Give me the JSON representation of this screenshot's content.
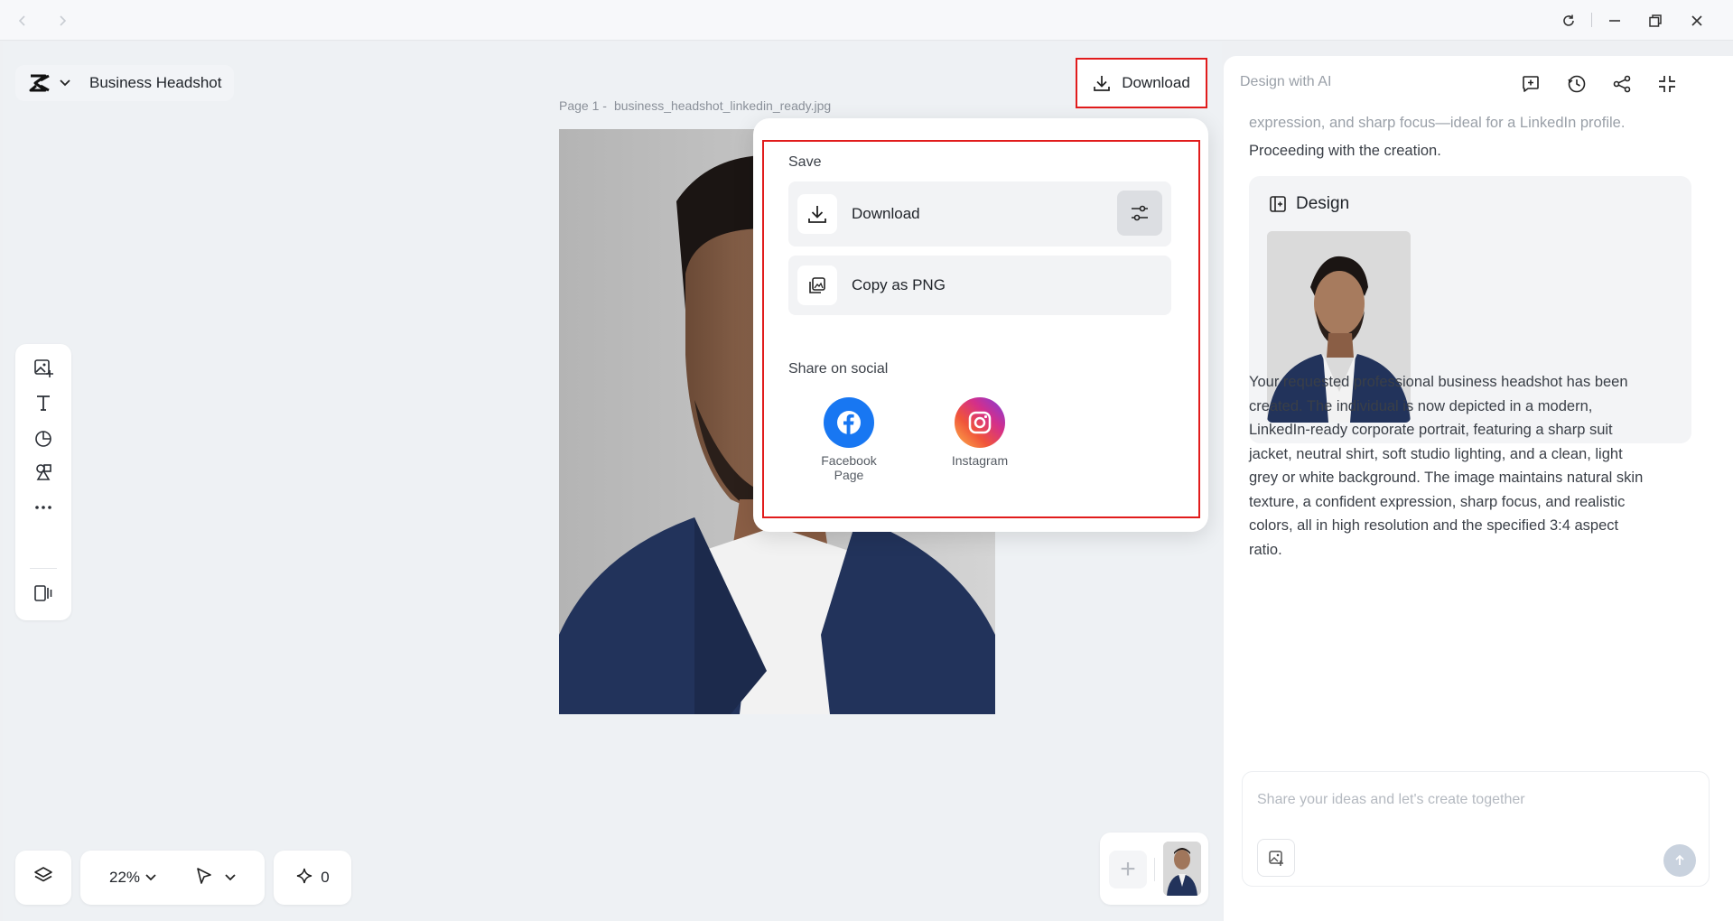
{
  "project": {
    "title": "Business Headshot"
  },
  "canvas": {
    "page_prefix": "Page 1 -",
    "file_name": "business_headshot_linkedin_ready.jpg",
    "zoom": "22%",
    "credits": "0"
  },
  "header": {
    "download_label": "Download"
  },
  "popover": {
    "save_heading": "Save",
    "download_label": "Download",
    "copy_label": "Copy as PNG",
    "share_heading": "Share on social",
    "social": [
      {
        "label_line1": "Facebook",
        "label_line2": "Page"
      },
      {
        "label_line1": "Instagram"
      }
    ]
  },
  "right_panel": {
    "title": "Design with AI",
    "faded_text": "expression, and sharp focus—ideal for a LinkedIn profile.",
    "proceed_text": "Proceeding with the creation.",
    "design_heading": "Design",
    "result_lines": [
      "Your requested professional business headshot has been",
      "created. The individual is now depicted in a modern,",
      "LinkedIn-ready corporate portrait, featuring a sharp suit",
      "jacket, neutral shirt, soft studio lighting, and a clean, light",
      "grey or white background. The image maintains natural skin",
      "texture, a confident expression, sharp focus, and realistic",
      "colors, all in high resolution and the specified 3:4 aspect",
      "ratio."
    ],
    "chat_placeholder": "Share your ideas and let's create together"
  },
  "colors": {
    "highlight": "#e11c1c",
    "facebook": "#1877f2",
    "suit": "#22335b"
  },
  "icons": [
    "back-icon",
    "forward-icon",
    "refresh-icon",
    "minimize-icon",
    "restore-icon",
    "close-icon",
    "logo-icon",
    "chevron-down-icon",
    "image-add-icon",
    "text-icon",
    "shape-icon",
    "elements-icon",
    "more-icon",
    "resize-icon",
    "layers-icon",
    "cursor-icon",
    "sparkle-icon",
    "plus-icon",
    "download-icon",
    "settings-sliders-icon",
    "copy-png-icon",
    "facebook-icon",
    "instagram-icon",
    "new-chat-icon",
    "history-icon",
    "share-icon",
    "collapse-icon",
    "design-icon",
    "attach-image-icon",
    "send-icon"
  ]
}
